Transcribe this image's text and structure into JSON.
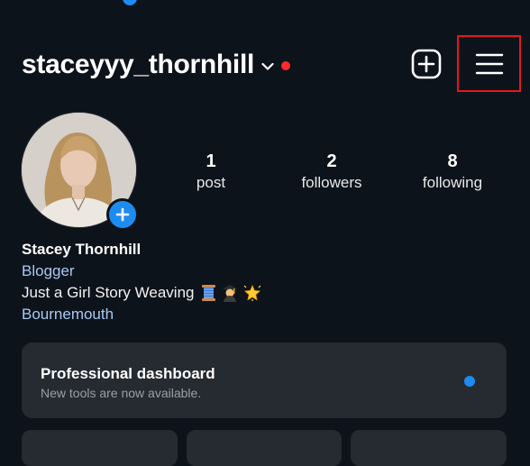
{
  "header": {
    "username": "staceyyy_thornhill"
  },
  "icons": {
    "chevron": "chevron-down-icon",
    "notification": "notification-dot",
    "create": "plus-square-icon",
    "menu": "hamburger-menu-icon",
    "add_story": "plus-icon"
  },
  "colors": {
    "background": "#0d131b",
    "accent": "#1d8cf0",
    "alert": "#ff2a2a",
    "highlight_box": "#e3191b",
    "link": "#a9c8f2"
  },
  "stats": {
    "posts": {
      "value": "1",
      "label": "post"
    },
    "followers": {
      "value": "2",
      "label": "followers"
    },
    "following": {
      "value": "8",
      "label": "following"
    }
  },
  "bio": {
    "name": "Stacey Thornhill",
    "category": "Blogger",
    "text": "Just a Girl Story Weaving",
    "emojis": [
      "thread-emoji",
      "woman-artist-emoji",
      "glowing-star-emoji"
    ],
    "location": "Bournemouth"
  },
  "dashboard": {
    "title": "Professional dashboard",
    "subtitle": "New tools are now available."
  }
}
